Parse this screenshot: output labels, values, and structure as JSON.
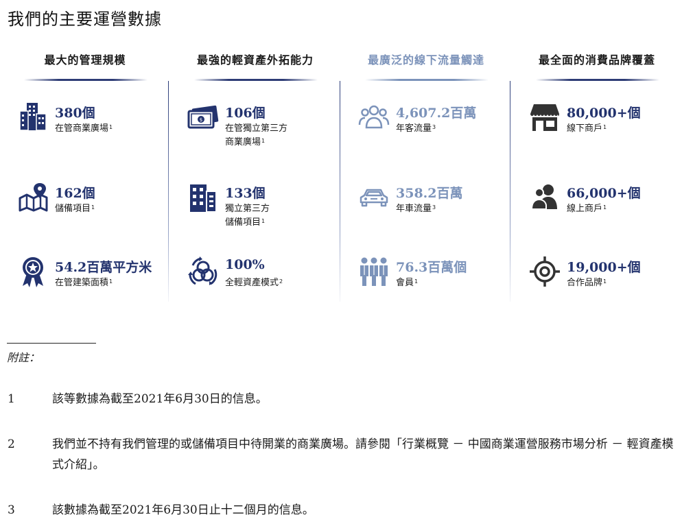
{
  "page_title": "我們的主要運營數據",
  "columns": [
    {
      "heading": "最大的管理規模",
      "metrics": [
        {
          "icon": "buildings-icon",
          "value": "380個",
          "desc": "在管商業廣場",
          "sup": "1"
        },
        {
          "icon": "map-pin-icon",
          "value": "162個",
          "desc": "儲備項目",
          "sup": "1"
        },
        {
          "icon": "award-ribbon-icon",
          "value": "54.2百萬平方米",
          "desc": "在管建築面積",
          "sup": "1"
        }
      ]
    },
    {
      "heading": "最強的輕資產外拓能力",
      "metrics": [
        {
          "icon": "money-icon",
          "value": "106個",
          "desc": "在管獨立第三方\n商業廣場",
          "sup": "1"
        },
        {
          "icon": "office-building-icon",
          "value": "133個",
          "desc": "獨立第三方\n儲備項目",
          "sup": "1"
        },
        {
          "icon": "cycle-arrows-icon",
          "value": "100%",
          "desc": "全輕資產模式",
          "sup": "2"
        }
      ]
    },
    {
      "heading": "最廣泛的線下流量觸達",
      "metrics": [
        {
          "icon": "people-group-icon",
          "value": "4,607.2百萬",
          "desc": "年客流量",
          "sup": "3"
        },
        {
          "icon": "car-icon",
          "value": "358.2百萬",
          "desc": "年車流量",
          "sup": "3"
        },
        {
          "icon": "members-icon",
          "value": "76.3百萬個",
          "desc": "會員",
          "sup": "1"
        }
      ]
    },
    {
      "heading": "最全面的消費品牌覆蓋",
      "metrics": [
        {
          "icon": "storefront-icon",
          "value": "80,000+個",
          "desc": "線下商戶",
          "sup": "1"
        },
        {
          "icon": "users-icon",
          "value": "66,000+個",
          "desc": "線上商戶",
          "sup": "1"
        },
        {
          "icon": "target-icon",
          "value": "19,000+個",
          "desc": "合作品牌",
          "sup": "1"
        }
      ]
    }
  ],
  "notes": {
    "label": "附註：",
    "items": [
      {
        "num": "1",
        "text": "該等數據為截至2021年6月30日的信息。"
      },
      {
        "num": "2",
        "text": "我們並不持有我們管理的或儲備項目中待開業的商業廣場。請參閱「行業概覽 － 中國商業運營服務市場分析 － 輕資產模式介紹」。"
      },
      {
        "num": "3",
        "text": "該數據為截至2021年6月30日止十二個月的信息。"
      }
    ]
  },
  "colors": {
    "navy": "#23336e",
    "light_blue": "#7c93ba"
  }
}
